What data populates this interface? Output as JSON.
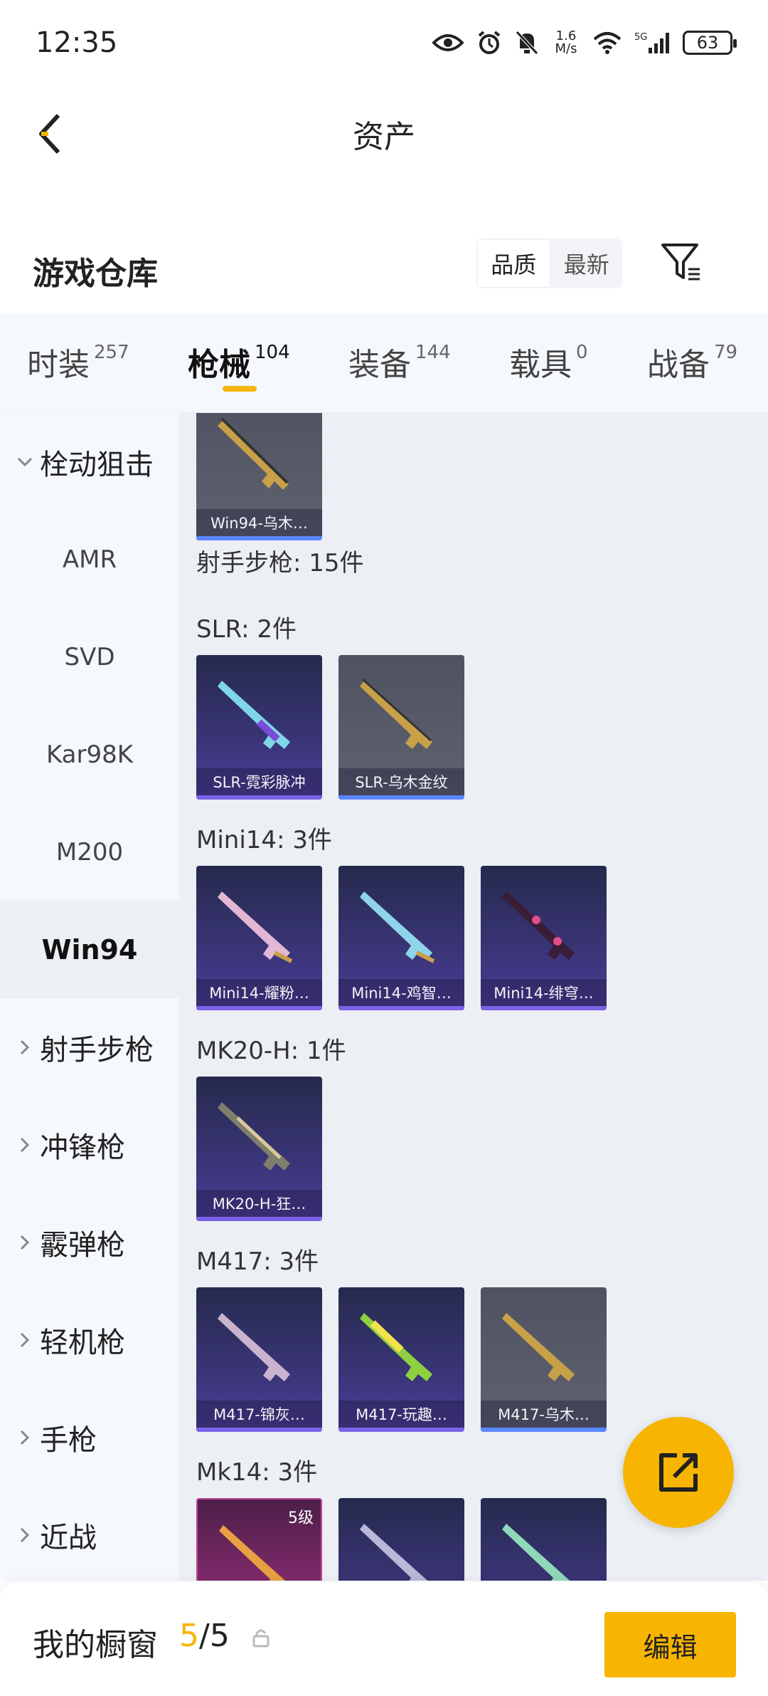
{
  "status_bar": {
    "time": "12:35",
    "net_speed_value": "1.6",
    "net_speed_unit": "M/s",
    "battery": "63"
  },
  "header": {
    "title": "资产",
    "back_icon": "chevron-left-icon"
  },
  "warehouse": {
    "title": "游戏仓库",
    "sort_options": [
      "品质",
      "最新"
    ],
    "sort_selected": "品质",
    "filter_icon": "filter-icon"
  },
  "tabs": [
    {
      "label": "时装",
      "count": "257"
    },
    {
      "label": "枪械",
      "count": "104",
      "active": true
    },
    {
      "label": "装备",
      "count": "144"
    },
    {
      "label": "载具",
      "count": "0"
    },
    {
      "label": "战备",
      "count": "79"
    }
  ],
  "sidebar": {
    "items": [
      {
        "label": "栓动狙击",
        "expanded": true
      },
      {
        "label": "AMR"
      },
      {
        "label": "SVD"
      },
      {
        "label": "Kar98K"
      },
      {
        "label": "M200"
      },
      {
        "label": "Win94",
        "active": true
      },
      {
        "label": "射手步枪"
      },
      {
        "label": "冲锋枪"
      },
      {
        "label": "霰弹枪"
      },
      {
        "label": "轻机枪"
      },
      {
        "label": "手枪"
      },
      {
        "label": "近战"
      }
    ]
  },
  "content": {
    "top_item": {
      "name": "Win94-乌木…"
    },
    "category_label": "射手步枪: 15件",
    "sections": [
      {
        "label": "SLR: 2件",
        "items": [
          {
            "name": "SLR-霓彩脉冲"
          },
          {
            "name": "SLR-乌木金纹"
          }
        ]
      },
      {
        "label": "Mini14: 3件",
        "items": [
          {
            "name": "Mini14-耀粉…"
          },
          {
            "name": "Mini14-鸡智…"
          },
          {
            "name": "Mini14-绯穹…"
          }
        ]
      },
      {
        "label": "MK20-H: 1件",
        "items": [
          {
            "name": "MK20-H-狂…"
          }
        ]
      },
      {
        "label": "M417: 3件",
        "items": [
          {
            "name": "M417-锦灰…"
          },
          {
            "name": "M417-玩趣…"
          },
          {
            "name": "M417-乌木…"
          }
        ]
      },
      {
        "label": "Mk14: 3件",
        "items": [
          {
            "level": "5级"
          },
          {},
          {}
        ]
      }
    ]
  },
  "fab_icon": "share-external-icon",
  "bottom_bar": {
    "label": "我的橱窗",
    "count_current": "5",
    "count_total": "/5",
    "lock_icon": "lock-icon",
    "edit_label": "编辑"
  },
  "colors": {
    "accent": "#f7b400",
    "card_purple": "#3a3578",
    "card_gray": "#5f6270",
    "card_pink": "#8b2d72"
  }
}
